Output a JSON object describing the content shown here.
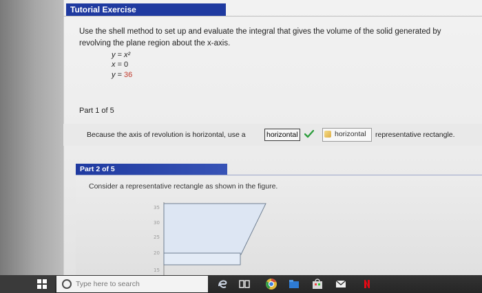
{
  "exercise": {
    "title": "Tutorial Exercise",
    "prompt": "Use the shell method to set up and evaluate the integral that gives the volume of the solid generated by revolving the plane region about the x-axis.",
    "equations": [
      {
        "lhs": "y",
        "rhs": "x²"
      },
      {
        "lhs": "x",
        "rhs": "0"
      },
      {
        "lhs": "y",
        "rhs": "36"
      }
    ]
  },
  "part1": {
    "label": "Part 1 of 5",
    "statement": "Because the axis of revolution is horizontal, use a",
    "answer": "horizontal",
    "answer_status": "correct",
    "hint_value": "horizontal",
    "suffix": "representative rectangle."
  },
  "part2": {
    "label": "Part 2 of 5",
    "text": "Consider a representative rectangle as shown in the figure.",
    "figure": {
      "y_tick_labels": [
        "35",
        "30",
        "25",
        "20",
        "15"
      ]
    }
  },
  "taskbar": {
    "search_placeholder": "Type here to search",
    "icons": [
      "windows-icon",
      "cortana-icon",
      "edge-icon",
      "task-view-icon",
      "chrome-icon",
      "file-explorer-icon",
      "store-icon",
      "mail-icon",
      "netflix-icon"
    ]
  },
  "colors": {
    "header_blue": "#1f3aa0",
    "check_green": "#2e9e3e",
    "highlight_red": "#c0392b",
    "figure_fill": "#dde6f3"
  }
}
